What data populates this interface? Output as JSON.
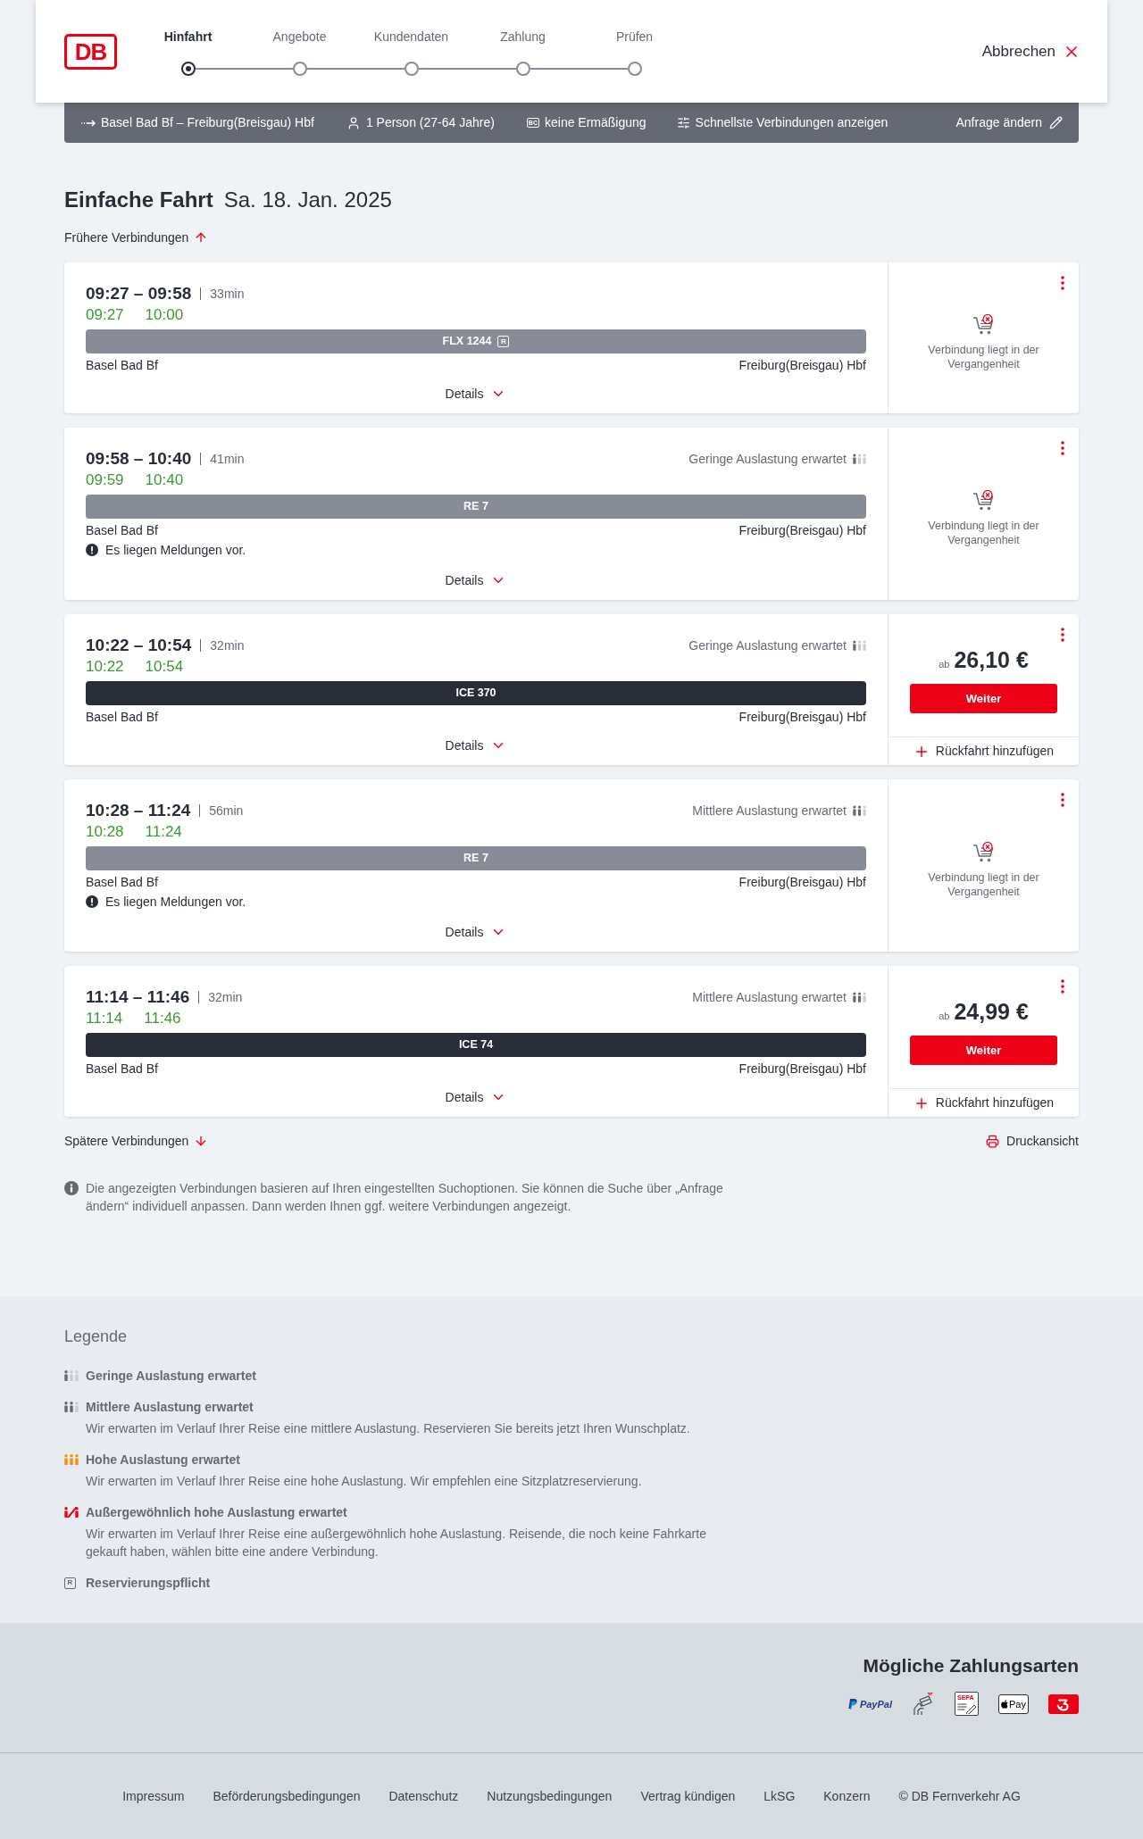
{
  "header": {
    "logo": "DB",
    "steps": [
      {
        "label": "Hinfahrt",
        "selected": true
      },
      {
        "label": "Angebote",
        "selected": false
      },
      {
        "label": "Kundendaten",
        "selected": false
      },
      {
        "label": "Zahlung",
        "selected": false
      },
      {
        "label": "Prüfen",
        "selected": false
      }
    ],
    "cancel": "Abbrechen"
  },
  "search_summary": {
    "route": "Basel Bad Bf – Freiburg(Breisgau) Hbf",
    "passengers": "1 Person (27-64 Jahre)",
    "discount_badge": "BC",
    "discount": "keine Ermäßigung",
    "option": "Schnellste Verbindungen anzeigen",
    "edit": "Anfrage ändern"
  },
  "heading": {
    "trip_type": "Einfache Fahrt",
    "date": "Sa. 18. Jan. 2025"
  },
  "earlier_link": "Frühere Verbindungen",
  "connections": [
    {
      "planned_times": "09:27 – 09:58",
      "duration": "33min",
      "actual_departure": "09:27",
      "actual_arrival": "10:00",
      "train": "FLX 1244",
      "reservation": "R",
      "from": "Basel Bad Bf",
      "to": "Freiburg(Breisgau) Hbf",
      "details": "Details",
      "offer": {
        "kind": "past",
        "message": "Verbindung liegt in der Vergangenheit"
      }
    },
    {
      "planned_times": "09:58 – 10:40",
      "duration": "41min",
      "occupancy": {
        "kind": "low",
        "label": "Geringe Auslastung erwartet"
      },
      "actual_departure": "09:59",
      "actual_arrival": "10:40",
      "train": "RE 7",
      "from": "Basel Bad Bf",
      "to": "Freiburg(Breisgau) Hbf",
      "notice": "Es liegen Meldungen vor.",
      "details": "Details",
      "offer": {
        "kind": "past",
        "message": "Verbindung liegt in der Vergangenheit"
      }
    },
    {
      "planned_times": "10:22 – 10:54",
      "duration": "32min",
      "occupancy": {
        "kind": "low",
        "label": "Geringe Auslastung erwartet"
      },
      "actual_departure": "10:22",
      "actual_arrival": "10:54",
      "train": "ICE 370",
      "from": "Basel Bad Bf",
      "to": "Freiburg(Breisgau) Hbf",
      "details": "Details",
      "offer": {
        "kind": "price",
        "prefix": "ab",
        "price": "26,10 €",
        "button": "Weiter",
        "return_trip": "Rückfahrt hinzufügen"
      }
    },
    {
      "planned_times": "10:28 – 11:24",
      "duration": "56min",
      "occupancy": {
        "kind": "medium",
        "label": "Mittlere Auslastung erwartet"
      },
      "actual_departure": "10:28",
      "actual_arrival": "11:24",
      "train": "RE 7",
      "from": "Basel Bad Bf",
      "to": "Freiburg(Breisgau) Hbf",
      "notice": "Es liegen Meldungen vor.",
      "details": "Details",
      "offer": {
        "kind": "past",
        "message": "Verbindung liegt in der Vergangenheit"
      }
    },
    {
      "planned_times": "11:14 – 11:46",
      "duration": "32min",
      "occupancy": {
        "kind": "medium",
        "label": "Mittlere Auslastung erwartet"
      },
      "actual_departure": "11:14",
      "actual_arrival": "11:46",
      "train": "ICE 74",
      "from": "Basel Bad Bf",
      "to": "Freiburg(Breisgau) Hbf",
      "details": "Details",
      "offer": {
        "kind": "price",
        "prefix": "ab",
        "price": "24,99 €",
        "button": "Weiter",
        "return_trip": "Rückfahrt hinzufügen"
      }
    }
  ],
  "later_link": "Spätere Verbindungen",
  "print_link": "Druckansicht",
  "info_note": "Die angezeigten Verbindungen basieren auf Ihren eingestellten Suchoptionen. Sie können die Suche über „Anfrage ändern“ individuell anpassen. Dann werden Ihnen ggf. weitere Verbindungen angezeigt.",
  "legend": {
    "title": "Legende",
    "items": [
      {
        "kind": "low",
        "title": "Geringe Auslastung erwartet"
      },
      {
        "kind": "medium",
        "title": "Mittlere Auslastung erwartet",
        "description": "Wir erwarten im Verlauf Ihrer Reise eine mittlere Auslastung. Reservieren Sie bereits jetzt Ihren Wunschplatz."
      },
      {
        "kind": "high",
        "title": "Hohe Auslastung erwartet",
        "description": "Wir erwarten im Verlauf Ihrer Reise eine hohe Auslastung. Wir empfehlen eine Sitzplatzreservierung."
      },
      {
        "kind": "extreme",
        "title": "Außergewöhnlich hohe Auslastung erwartet",
        "description": "Wir erwarten im Verlauf Ihrer Reise eine außergewöhnlich hohe Auslastung. Reisende, die noch keine Fahrkarte gekauft haben, wählen bitte eine andere Verbindung."
      },
      {
        "kind": "reservation",
        "symbol": "R",
        "title": "Reservierungspflicht"
      }
    ]
  },
  "payment": {
    "title": "Mögliche Zahlungsarten",
    "methods": [
      {
        "kind": "paypal",
        "label": "PayPal"
      },
      {
        "kind": "contactless"
      },
      {
        "kind": "sepa",
        "label": "SEPA"
      },
      {
        "kind": "applepay",
        "label": "Pay"
      },
      {
        "kind": "db"
      }
    ]
  },
  "footer": {
    "links": [
      "Impressum",
      "Beförderungsbedingungen",
      "Datenschutz",
      "Nutzungsbedingungen",
      "Vertrag kündigen",
      "LkSG",
      "Konzern"
    ],
    "copyright": "© DB Fernverkehr AG"
  }
}
